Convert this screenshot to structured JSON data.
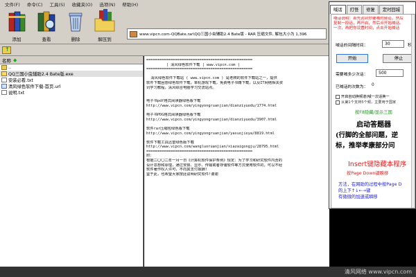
{
  "menu": [
    "文件(F)",
    "命令(C)",
    "工具(S)",
    "收藏夹(O)",
    "选项(N)",
    "帮助(H)"
  ],
  "toolbar": {
    "add": "添加",
    "view": "查看",
    "delete": "删除",
    "extract": "解压到"
  },
  "address": {
    "text": "www.vipcn.com-QQBate.rar\\QQ三国小虫辅助2.4 Bate版 - RAR 压缩文件, 解包大小为 1,396"
  },
  "list": {
    "header": "名称",
    "rows": [
      {
        "name": "..",
        "type": "folder"
      },
      {
        "name": "QQ三国小虫辅助2.4 Bate版.exe",
        "type": "exe"
      },
      {
        "name": "安装必看.txt",
        "type": "txt"
      },
      {
        "name": "清风绿色软件下载-首页.url",
        "type": "url"
      },
      {
        "name": "说明.txt",
        "type": "txt"
      }
    ]
  },
  "textpane": {
    "lines": [
      "================================================",
      "         | 清风绿色软件下载 | www.vipcn.com |",
      "================================================",
      "",
      "  清风绿色软件下载站 ( www.vipcn.com ) 是老牌的软件下载站之一，提供",
      "软件下载困惑绿色软件下载，单机游戏下载，免费电子书籍下载，以及IT网络相关资",
      "讯学习教程，清风综合电脑学习交流站点。",
      "",
      "",
      "电子书pdf格式阅读器绿色版下载",
      "http://www.vipcn.com/yingyongruanjian/dianziyuedu/1774.html",
      "",
      "电子书PDG格式阅读器绿色版下载",
      "http://www.vipcn.com/yingyongruanjian/dianziyuedu/3907.html",
      "",
      "软件rar压缩包绿色版下载",
      "http://www.vipcn.com/yingyongruanjian/yasuojieya/8819.html",
      "",
      "软件下载工具迅雷绿色版下载",
      "http://www.vipcn.com/wangluoruanjian/xiazaigongju/28795.html",
      "================================================",
      "附：",
      "根据二〇〇二年一月一日《计算机软件保护条例》规定：为了学习和研究软件内含的",
      "设计思想和原理，通过安装、显示、传输或者存储软件等方式使用软件的，可以不经",
      "软件著作权人许可，不向其支付报酬!",
      "鉴于此，也希望大家按此说明研究软件!谢谢"
    ]
  },
  "dialog": {
    "tabs": [
      "喊话",
      "打怪",
      "修复",
      "定时回城"
    ],
    "tip_lines": [
      "喊话说明：首先调到你要喊的频道，然后",
      "复制一段话，再开启，然后点开始喊话。",
      "一次，再把你设置时间，点击开始喊话"
    ],
    "interval_label": "喊话的间隔时间：",
    "interval_value": "30",
    "interval_unit": "秒",
    "start": "开始",
    "stop": "停止",
    "max_label": "需要喊多少次话：",
    "max_value": "500",
    "count_label": "已喊话的次数为：",
    "count_value": "0",
    "check1": "开启自动换频道(喊一次话换一",
    "check2": "从第1个支持5个频，主要用于国家",
    "green_link": "按F8隐藏/显示三国",
    "big_title": "启动答题器",
    "big_line1": "(行脚的全部问题，逆",
    "big_line2": "标，推举孝康部分问",
    "insert_text": "Insert键隐藏本程序",
    "red_line1": "按Page Down键瞬移",
    "blue_line1": "方法，在网助的过程中按Page D",
    "blue_line2": "的上下↑↓←→键",
    "blue_line3": "有微微的加速或瞬移"
  },
  "watermark": "清风网络 www.vipcn.com"
}
